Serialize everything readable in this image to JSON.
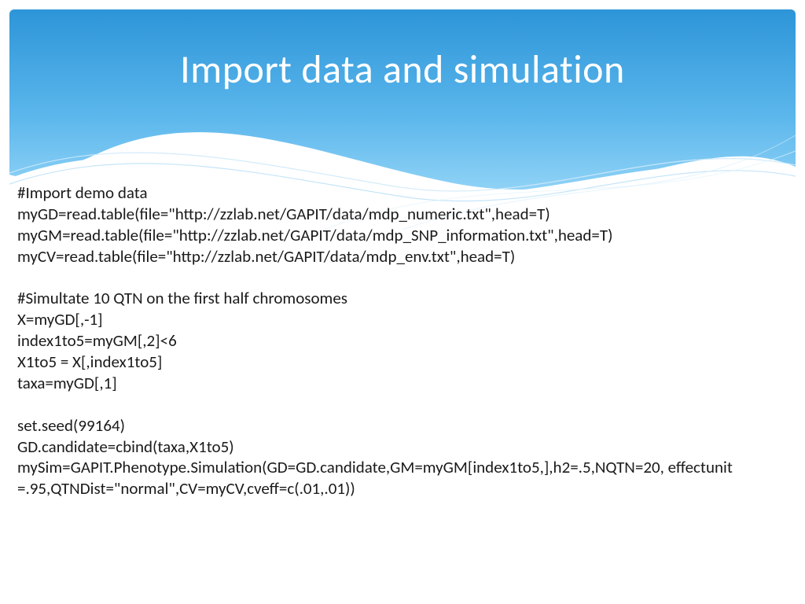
{
  "slide": {
    "title": "Import data and simulation",
    "body": "#Import demo data\nmyGD=read.table(file=\"http://zzlab.net/GAPIT/data/mdp_numeric.txt\",head=T)\nmyGM=read.table(file=\"http://zzlab.net/GAPIT/data/mdp_SNP_information.txt\",head=T)\nmyCV=read.table(file=\"http://zzlab.net/GAPIT/data/mdp_env.txt\",head=T)\n\n#Simultate 10 QTN on the first half chromosomes\nX=myGD[,-1]\nindex1to5=myGM[,2]<6\nX1to5 = X[,index1to5]\ntaxa=myGD[,1]\n\nset.seed(99164)\nGD.candidate=cbind(taxa,X1to5)\nmySim=GAPIT.Phenotype.Simulation(GD=GD.candidate,GM=myGM[index1to5,],h2=.5,NQTN=20, effectunit =.95,QTNDist=\"normal\",CV=myCV,cveff=c(.01,.01))"
  },
  "colors": {
    "wave_top": "#3ba5e6",
    "wave_mid": "#5fb8ec",
    "wave_light": "#a8d9f5",
    "text_dark": "#1a1a1a",
    "title": "#ffffff"
  }
}
